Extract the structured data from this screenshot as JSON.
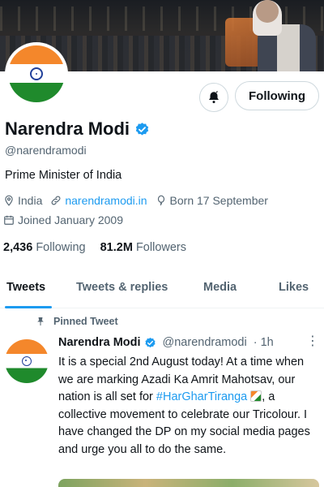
{
  "profile": {
    "name": "Narendra Modi",
    "handle": "@narendramodi",
    "bio": "Prime Minister of India",
    "location": "India",
    "website": "narendramodi.in",
    "born": "Born 17 September",
    "joined": "Joined January 2009",
    "following_count": "2,436",
    "following_label": "Following",
    "followers_count": "81.2M",
    "followers_label": "Followers",
    "verified": true
  },
  "actions": {
    "follow_button": "Following",
    "notify_icon": "bell-icon"
  },
  "tabs": [
    {
      "label": "Tweets",
      "active": true
    },
    {
      "label": "Tweets & replies",
      "active": false
    },
    {
      "label": "Media",
      "active": false
    },
    {
      "label": "Likes",
      "active": false
    }
  ],
  "pinned_tweet": {
    "pinned_label": "Pinned Tweet",
    "author_name": "Narendra Modi",
    "author_handle": "@narendramodi",
    "time": "· 1h",
    "text_part1": "It is a special 2nd August today! At a time when we are marking Azadi Ka Amrit Mahotsav, our nation is all set for ",
    "hashtag": "#HarGharTiranga",
    "text_part2": ", a collective movement to celebrate our Tricolour. I have changed the DP on my social media pages and urge you all to do the same."
  },
  "colors": {
    "accent": "#1d9bf0",
    "text_primary": "#0f1419",
    "text_secondary": "#536471",
    "flag_saffron": "#f4872b",
    "flag_green": "#1f8a2c",
    "chakra_blue": "#21409a"
  }
}
